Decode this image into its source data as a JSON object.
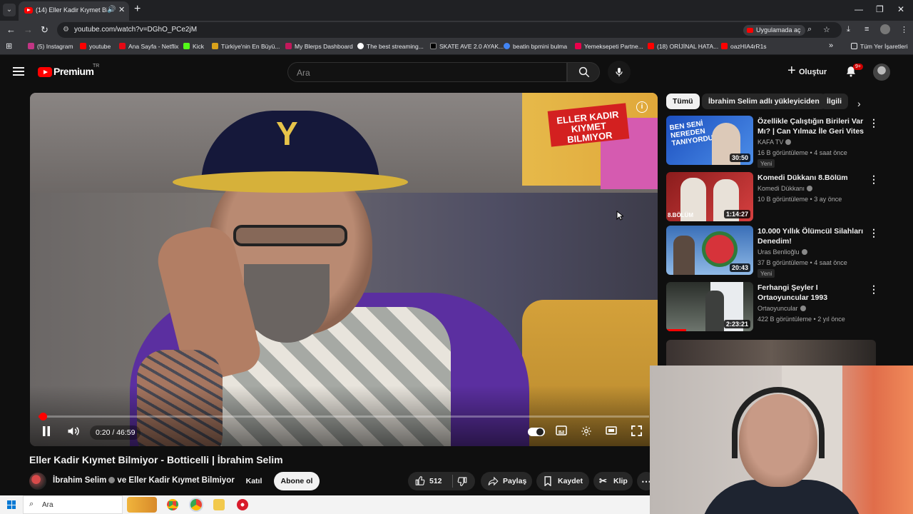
{
  "browser": {
    "tab_title": "(14) Eller Kadir Kıymet Bilm",
    "url": "youtube.com/watch?v=DGhO_PCe2jM",
    "open_in_app": "Uygulamada aç",
    "bookmarks": [
      {
        "label": "(5) Instagram",
        "color": "#c13584"
      },
      {
        "label": "youtube",
        "color": "#ff0000"
      },
      {
        "label": "Ana Sayfa - Netflix",
        "color": "#e50914"
      },
      {
        "label": "Kick",
        "color": "#53fc18"
      },
      {
        "label": "Türkiye'nin En Büyü...",
        "color": "#d9a21b"
      },
      {
        "label": "My Blerps Dashboard",
        "color": "#c2185b"
      },
      {
        "label": "The best streaming...",
        "color": "#ffffff"
      },
      {
        "label": "SKATE AVE 2.0 AYAK...",
        "color": "#000000"
      },
      {
        "label": "beatin bpmini bulma",
        "color": "#4285f4"
      },
      {
        "label": "Yemeksepeti Partne...",
        "color": "#ea004b"
      },
      {
        "label": "(18) ORİJİNAL HATA...",
        "color": "#ff0000"
      },
      {
        "label": "oazHIA4rR1s",
        "color": "#ff0000"
      }
    ],
    "all_bookmarks": "Tüm Yer İşaretleri"
  },
  "youtube": {
    "logo_text": "Premium",
    "logo_region": "TR",
    "search_placeholder": "Ara",
    "create_label": "Oluştur",
    "notif_count": "9+"
  },
  "player": {
    "overlay_text": "ELLER KADIR KIYMET BILMIYOR",
    "time_current": "0:20",
    "time_sep": "/",
    "time_total": "46:59",
    "progress": 0.007
  },
  "video": {
    "title": "Eller Kadir Kıymet Bilmiyor - Botticelli | İbrahim Selim",
    "channel_a": "İbrahim Selim",
    "channel_join": "ve",
    "channel_b": "Eller Kadir Kıymet Bilmiyor",
    "join_label": "Katıl",
    "subscribe_label": "Abone ol",
    "likes": "512",
    "share_label": "Paylaş",
    "save_label": "Kaydet",
    "clip_label": "Klip"
  },
  "chips": [
    "Tümü",
    "İbrahim Selim adlı yükleyiciden",
    "İlgili"
  ],
  "recommendations": [
    {
      "title": "Özellikle Çalıştığın Birileri Var Mı? | Can Yılmaz İle Geri Vites",
      "channel": "KAFA TV",
      "meta": "16 B görüntüleme • 4 saat önce",
      "badge": "Yeni",
      "duration": "30:50",
      "thumb_text": "BEN SENİ NEREDEN TANIYORDUM?",
      "thumb_colors": [
        "#1c4fbf",
        "#4c8ee8"
      ]
    },
    {
      "title": "Komedi Dükkanı 8.Bölüm",
      "channel": "Komedi Dükkanı",
      "meta": "10 B görüntüleme • 3 ay önce",
      "badge": "",
      "duration": "1:14:27",
      "thumb_text": "8.BÖLÜM",
      "thumb_colors": [
        "#8a1c1c",
        "#d64040"
      ]
    },
    {
      "title": "10.000 Yıllık Ölümcül Silahları Denedim!",
      "channel": "Uras Benlioğlu",
      "meta": "37 B görüntüleme • 4 saat önce",
      "badge": "Yeni",
      "duration": "20:43",
      "thumb_text": "",
      "thumb_colors": [
        "#3a6fb8",
        "#8fb9e6"
      ]
    },
    {
      "title": "Ferhangi Şeyler I Ortaoyuncular 1993",
      "channel": "Ortaoyuncular",
      "meta": "422 B görüntüleme • 2 yıl önce",
      "badge": "",
      "duration": "2:23:21",
      "thumb_text": "",
      "thumb_colors": [
        "#2a2e2a",
        "#6d756d"
      ]
    }
  ],
  "taskbar": {
    "search_placeholder": "Ara"
  }
}
